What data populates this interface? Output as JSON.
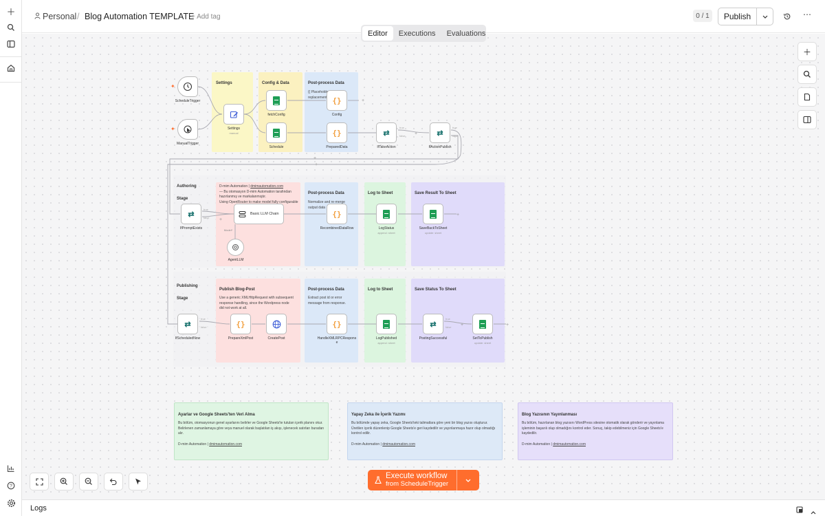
{
  "breadcrumb": {
    "workspace": "Personal",
    "separator": "/",
    "workflow_name": "Blog Automation TEMPLATE",
    "add_tag": "+ Add tag"
  },
  "header": {
    "counter": "0 / 1",
    "publish": "Publish"
  },
  "tabs": [
    {
      "label": "Editor"
    },
    {
      "label": "Executions"
    },
    {
      "label": "Evaluations"
    }
  ],
  "groups": {
    "settings": {
      "title": "Settings"
    },
    "config": {
      "title": "Config & Data"
    },
    "post1": {
      "title": "Post-process Data",
      "text": "{{ Placeholders replacement"
    },
    "authoring": {
      "title": "Authoring",
      "stage": "Stage"
    },
    "author_note": {
      "text1": "D-mim Automation | ",
      "link": "dmimautomation.com",
      "text2": "— Bu otomasyon D-mim Automation tarafından hazırlanmış ve markalanmıştır.",
      "text3": "Using OpenRouter to make model fully configurable"
    },
    "post2": {
      "title": "Post-process Data",
      "text": "Normalize and re-merge output data"
    },
    "log1": {
      "title": "Log to Sheet"
    },
    "save1": {
      "title": "Save Result To Sheet"
    },
    "publishing": {
      "title": "Publishing",
      "stage": "Stage"
    },
    "publish_post": {
      "title": "Publish Blog-Post",
      "text": "Use a generic XMLHttpRequest with subsequent response handling, since the Wordpress node did not work at all."
    },
    "post3": {
      "title": "Post-process Data",
      "text": "Extract post id or error message from response."
    },
    "log2": {
      "title": "Log to Sheet"
    },
    "save2": {
      "title": "Save Status To Sheet"
    }
  },
  "nodes": {
    "schedule_trigger": "ScheduleTrigger",
    "manual_trigger": "ManualTrigger",
    "settings": "Settings",
    "settings_sub": "manual",
    "fetch_config": "fetchConfig",
    "schedule": "Schedule",
    "config": "Config",
    "prepared_data": "PreparedData",
    "if_take_action": "IfTakeAction",
    "if_action_publish": "IfActionPublish",
    "if_prompt_exists": "IfPromptExists",
    "basic_llm_chain": "Basic LLM Chain",
    "agent_llm": "AgentLLM",
    "model_label": "Model*",
    "recombined": "RecombinedDataRow",
    "log_status": "LogStatus",
    "log_status_sub": "append: sheet",
    "save_back": "SaveBackToSheet",
    "save_back_sub": "update: sheet",
    "if_scheduled_now": "IfScheduledNow",
    "prepare_xml": "PrepareXmlPost",
    "create_post": "CreatePost",
    "handle_xml": "HandleXMLRPCRespons\ne",
    "log_published": "LogPublished",
    "log_published_sub": "append: sheet",
    "posting_successful": "PostingSuccessful",
    "set_to_publish": "SetToPublish",
    "set_to_publish_sub": "update: sheet",
    "true_label": "true",
    "false_label": "false"
  },
  "notes": [
    {
      "title": "Ayarlar ve Google Sheets'ten Veri Alma",
      "body": "Bu bölüm, otomasyonun genel ayarlarını belirler ve Google Sheets'te tutulan içerik planını okur. Belirlenen zamanlamaya göre veya manuel olarak başlatılan iş akışı, işlenecek satırları buradan alır.",
      "footer": "D-mim Automation | ",
      "link": "dmimautomation.com",
      "color": "#dff5e3"
    },
    {
      "title": "Yapay Zeka ile İçerik Yazımı",
      "body": "Bu bölümde yapay zeka, Google Sheets'teki talimatlara göre yeni bir blog yazısı oluşturur. Üretilen içerik düzenlenip Google Sheets'e geri kaydedilir ve yayınlanmaya hazır olup olmadığı kontrol edilir.",
      "footer": "D-mim Automation | ",
      "link": "dmimautomation.com",
      "color": "#dde9f7"
    },
    {
      "title": "Blog Yazısının Yayınlanması",
      "body": "Bu bölüm, hazırlanan blog yazısını WordPress sitesine otomatik olarak gönderir ve yayınlama işleminin başarılı olup olmadığını kontrol eder. Sonuç, takip edebilmeniz için Google Sheets'e kaydedilir.",
      "footer": "D-mim Automation | ",
      "link": "dmimautomation.com",
      "color": "#e6dffa"
    }
  ],
  "execute": {
    "label": "Execute workflow",
    "sub": "from ScheduleTrigger"
  },
  "logs": {
    "label": "Logs"
  },
  "colors": {
    "accent": "#ff6d2d",
    "yellow": "#fbf7c6",
    "orange": "#fbe9c2",
    "blue": "#dbe8f8",
    "red": "#fde0df",
    "green": "#dcf5df",
    "purple": "#e0dbfa"
  }
}
